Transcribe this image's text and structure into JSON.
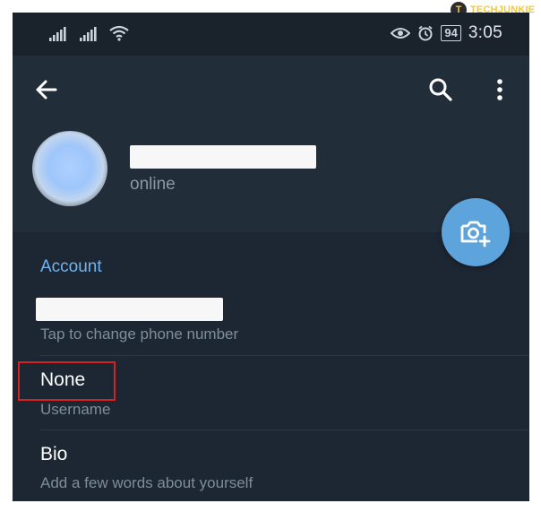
{
  "watermark": {
    "logo_letter": "T",
    "brand": "TECHJUNKIE"
  },
  "status_bar": {
    "battery": "94",
    "time": "3:05",
    "icons": [
      "signal-icon",
      "signal-icon",
      "wifi-icon",
      "eye-icon",
      "alarm-icon",
      "battery-icon"
    ]
  },
  "toolbar": {
    "back_icon": "back-arrow-icon",
    "search_icon": "search-icon",
    "menu_icon": "more-vertical-icon"
  },
  "profile": {
    "status": "online",
    "fab_icon": "camera-add-icon"
  },
  "account": {
    "title": "Account",
    "phone_caption": "Tap to change phone number",
    "username_value": "None",
    "username_caption": "Username",
    "bio_title": "Bio",
    "bio_caption": "Add a few words about yourself"
  },
  "colors": {
    "background": "#1d2733",
    "accent": "#71b3ee",
    "fab": "#5da3dc",
    "highlight": "#d42121"
  }
}
